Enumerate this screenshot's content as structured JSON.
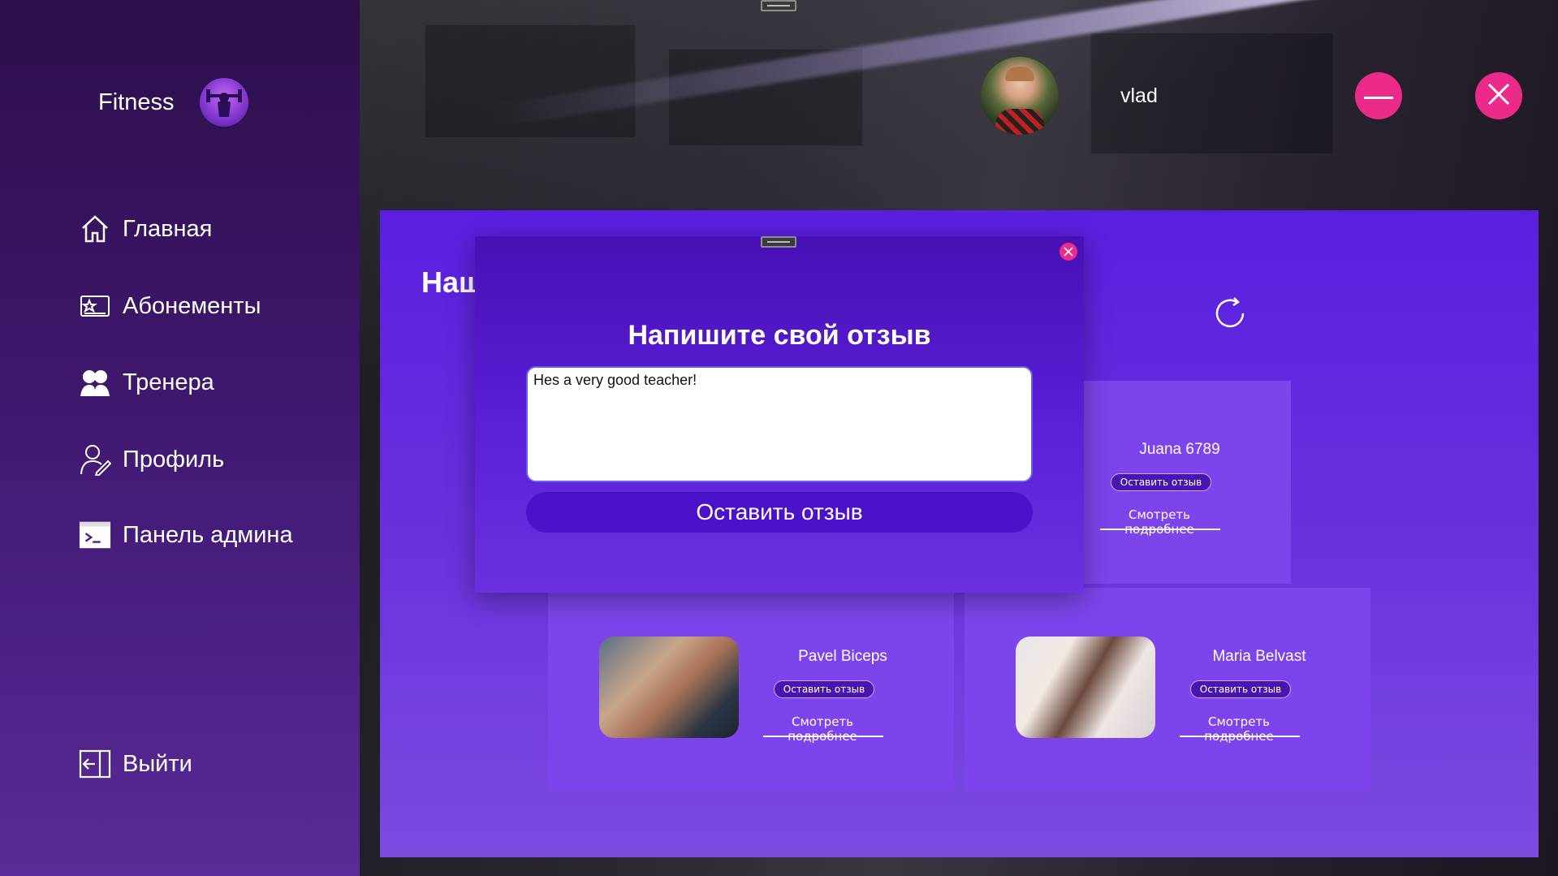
{
  "app": {
    "brand_title": "Fitness",
    "logo_icon": "fitness-logo-icon"
  },
  "sidebar": {
    "items": [
      {
        "label": "Главная",
        "icon": "home-icon"
      },
      {
        "label": "Абонементы",
        "icon": "membership-card-icon"
      },
      {
        "label": "Тренера",
        "icon": "trainers-icon"
      },
      {
        "label": "Профиль",
        "icon": "profile-icon"
      },
      {
        "label": "Панель админа",
        "icon": "terminal-icon"
      }
    ],
    "logout": {
      "label": "Выйти",
      "icon": "logout-icon"
    }
  },
  "header": {
    "username": "vlad",
    "minimize_icon": "minus-icon",
    "close_icon": "close-icon"
  },
  "main": {
    "title_partial": "Наш",
    "refresh_icon": "refresh-icon",
    "trainers": [
      {
        "name": "Juana 6789",
        "review_button": "Оставить отзыв",
        "details_link": "Смотреть подробнее"
      },
      {
        "name": "Pavel Biceps",
        "review_button": "Оставить отзыв",
        "details_link": "Смотреть подробнее"
      },
      {
        "name": "Maria Belvast",
        "review_button": "Оставить отзыв",
        "details_link": "Смотреть подробнее"
      }
    ]
  },
  "modal": {
    "title": "Напишите свой отзыв",
    "review_text": "Hes a very good teacher!",
    "submit_label": "Оставить отзыв"
  },
  "colors": {
    "accent_pink": "#ec2a8a",
    "panel_purple": "#6a30dc",
    "button_purple": "#4c12c9"
  }
}
